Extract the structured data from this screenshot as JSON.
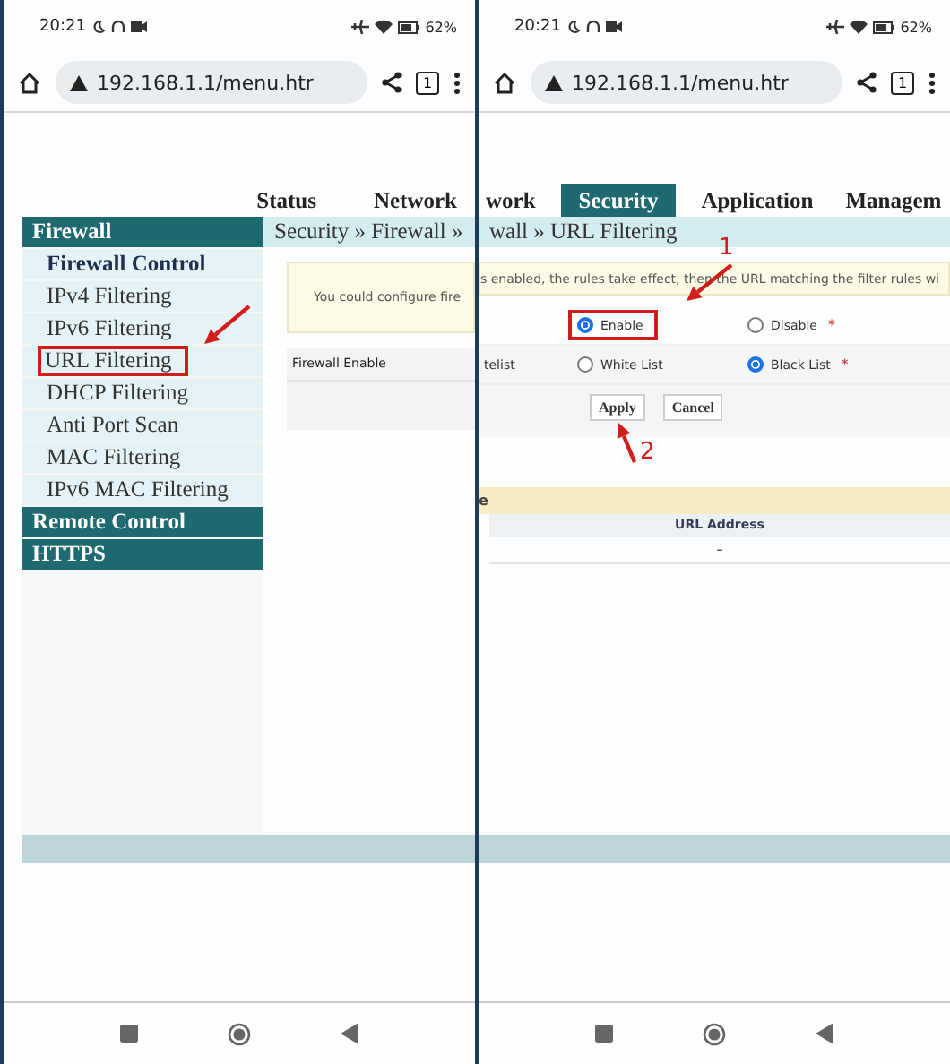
{
  "left_screen": {
    "status_bar": {
      "time": "20:21",
      "battery": "62%"
    },
    "address_bar": {
      "url": "192.168.1.1/menu.htr",
      "tab_count": "1"
    },
    "top_nav": [
      {
        "label": "Status",
        "selected": false
      },
      {
        "label": "Network",
        "selected": false
      }
    ],
    "sidebar": [
      {
        "label": "Firewall",
        "expanded": true,
        "children": [
          {
            "label": "Firewall Control",
            "selected": true,
            "highlighted": false
          },
          {
            "label": "IPv4 Filtering",
            "selected": false,
            "highlighted": false
          },
          {
            "label": "IPv6 Filtering",
            "selected": false,
            "highlighted": false
          },
          {
            "label": "URL Filtering",
            "selected": false,
            "highlighted": true
          },
          {
            "label": "DHCP Filtering",
            "selected": false,
            "highlighted": false
          },
          {
            "label": "Anti Port Scan",
            "selected": false,
            "highlighted": false
          },
          {
            "label": "MAC Filtering",
            "selected": false,
            "highlighted": false
          },
          {
            "label": "IPv6 MAC Filtering",
            "selected": false,
            "highlighted": false
          }
        ]
      },
      {
        "label": "Remote Control"
      },
      {
        "label": "HTTPS"
      }
    ],
    "breadcrumb": "Security » Firewall »",
    "notice": "You could configure fire",
    "form_rows": [
      {
        "label": "Firewall Enable"
      }
    ],
    "annotations": [
      {
        "kind": "arrow"
      }
    ]
  },
  "right_screen": {
    "status_bar": {
      "time": "20:21",
      "battery": "62%"
    },
    "address_bar": {
      "url": "192.168.1.1/menu.htr",
      "tab_count": "1"
    },
    "top_nav": [
      {
        "label": "work",
        "selected": false
      },
      {
        "label": "Security",
        "selected": true
      },
      {
        "label": "Application",
        "selected": false
      },
      {
        "label": "Managem",
        "selected": false
      }
    ],
    "breadcrumb": "wall » URL Filtering",
    "notice": "s enabled, the rules take effect, then the URL matching the filter rules wi",
    "form_rows": [
      {
        "options": [
          {
            "label": "Enable",
            "selected": true,
            "highlighted": true
          },
          {
            "label": "Disable",
            "selected": false,
            "highlighted": false
          }
        ],
        "required_mark": "*"
      },
      {
        "label": "telist",
        "options": [
          {
            "label": "White List",
            "selected": false,
            "highlighted": false
          },
          {
            "label": "Black List",
            "selected": true,
            "highlighted": false
          }
        ],
        "required_mark": "*"
      }
    ],
    "buttons": [
      "Apply",
      "Cancel"
    ],
    "list_section": {
      "title": "e",
      "columns": [
        "URL Address"
      ],
      "rows": [
        [
          "–"
        ]
      ]
    },
    "annotations": [
      {
        "kind": "arrow",
        "label": "1"
      },
      {
        "kind": "arrow",
        "label": "2"
      }
    ]
  }
}
